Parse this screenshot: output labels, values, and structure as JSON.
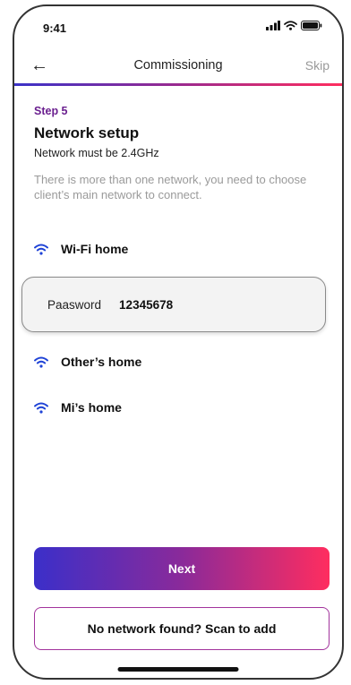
{
  "status_bar": {
    "time": "9:41"
  },
  "nav": {
    "title": "Commissioning",
    "skip_label": "Skip"
  },
  "content": {
    "step": "Step 5",
    "title": "Network setup",
    "subtitle": "Network must be 2.4GHz",
    "description": "There is more than one network, you need to choose client’s main network to connect."
  },
  "networks": [
    {
      "name": "Wi-Fi home"
    },
    {
      "name": "Other’s home"
    },
    {
      "name": "Mi’s home"
    }
  ],
  "password": {
    "label": "Paasword",
    "value": "12345678"
  },
  "buttons": {
    "next_label": "Next",
    "scan_label": "No network found? Scan to add"
  },
  "colors": {
    "accent_start": "#3b2fc9",
    "accent_end": "#ff2d5f",
    "step_color": "#6a1f8f",
    "wifi_icon": "#1f43d6"
  }
}
